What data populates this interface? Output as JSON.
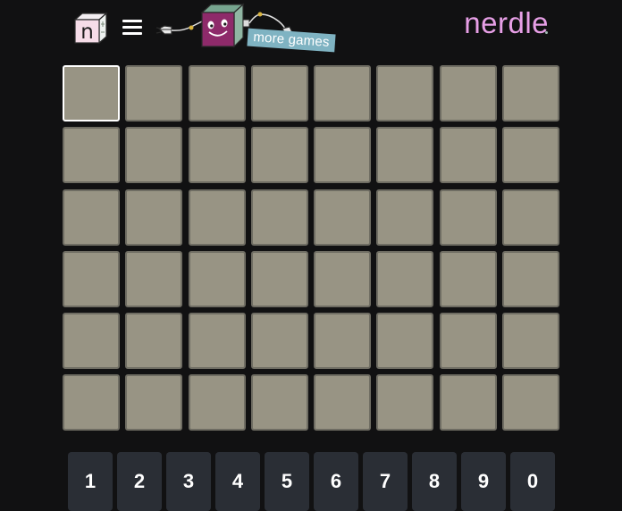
{
  "header": {
    "logo_letter": "n",
    "promo_label": "more games",
    "brand": "nerdle"
  },
  "colors": {
    "background": "#111112",
    "tile": "#989484",
    "tile_border": "#6f6d63",
    "active_border": "#ffffff",
    "key": "#2a2e35",
    "brand": "#e79fe6",
    "promo_tag": "#7fb3c2"
  },
  "board": {
    "rows": 6,
    "columns": 8,
    "active_row": 0,
    "active_col": 0
  },
  "keyboard": {
    "keys": [
      "1",
      "2",
      "3",
      "4",
      "5",
      "6",
      "7",
      "8",
      "9",
      "0"
    ]
  }
}
